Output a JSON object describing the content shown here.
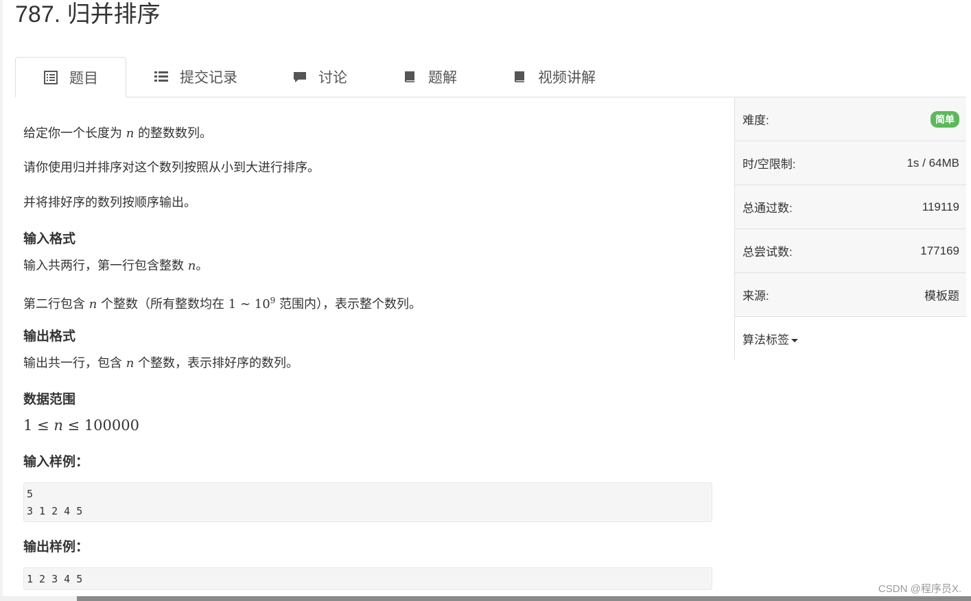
{
  "page_title": "787. 归并排序",
  "tabs": [
    {
      "label": "题目",
      "icon": "list-alt-icon"
    },
    {
      "label": "提交记录",
      "icon": "list-icon"
    },
    {
      "label": "讨论",
      "icon": "comment-icon"
    },
    {
      "label": "题解",
      "icon": "book-icon"
    },
    {
      "label": "视频讲解",
      "icon": "book-icon"
    }
  ],
  "problem": {
    "p1": {
      "a": "给定你一个长度为 ",
      "var": "n",
      "b": " 的整数数列。"
    },
    "p2": "请你使用归并排序对这个数列按照从小到大进行排序。",
    "p3": "并将排好序的数列按顺序输出。",
    "input_heading": "输入格式",
    "input_line1": {
      "a": "输入共两行，第一行包含整数 ",
      "var": "n",
      "b": "。"
    },
    "input_line2": {
      "a": "第二行包含 ",
      "var": "n",
      "b": " 个整数（所有整数均在 ",
      "range_low": "1",
      "tilde": " ∼ ",
      "base": "10",
      "exp": "9",
      "c": " 范围内），表示整个数列。"
    },
    "output_heading": "输出格式",
    "output_line": {
      "a": "输出共一行，包含 ",
      "var": "n",
      "b": " 个整数，表示排好序的数列。"
    },
    "range_heading": "数据范围",
    "range_expr": {
      "low": "1",
      "le1": " ≤ ",
      "var": "n",
      "le2": " ≤ ",
      "high": "100000"
    },
    "sample_input_heading": "输入样例：",
    "sample_input": "5\n3 1 2 4 5",
    "sample_output_heading": "输出样例：",
    "sample_output": "1 2 3 4 5"
  },
  "sidebar": {
    "difficulty_label": "难度:",
    "difficulty_value": "简单",
    "limit_label": "时/空限制:",
    "limit_value": "1s / 64MB",
    "passed_label": "总通过数:",
    "passed_value": "119119",
    "tried_label": "总尝试数:",
    "tried_value": "177169",
    "source_label": "来源:",
    "source_value": "模板题",
    "tags_label": "算法标签"
  },
  "watermark": "CSDN @程序员X."
}
